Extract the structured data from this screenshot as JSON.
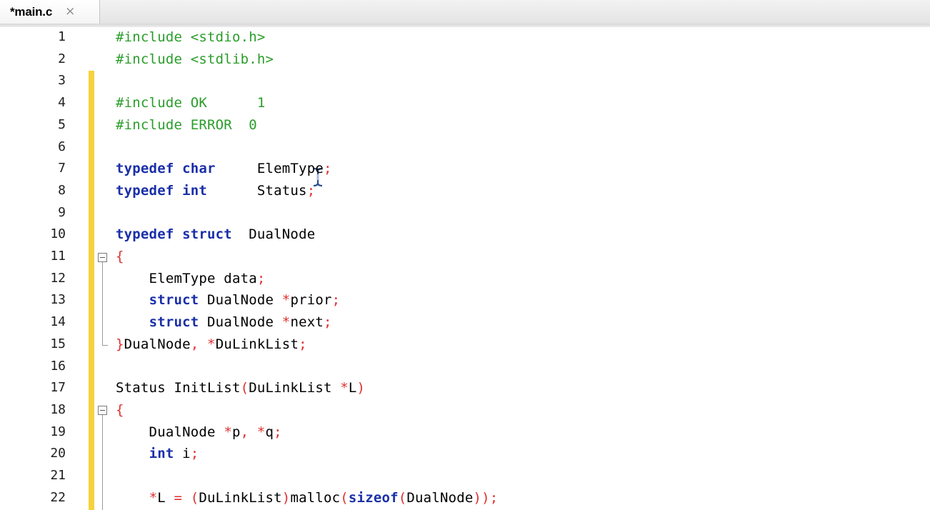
{
  "tab": {
    "title": "*main.c",
    "close_glyph": "×"
  },
  "lines": [
    {
      "n": "1",
      "tokens": [
        [
          "pp",
          "#include <stdio.h>"
        ]
      ]
    },
    {
      "n": "2",
      "tokens": [
        [
          "pp",
          "#include <stdlib.h>"
        ]
      ]
    },
    {
      "n": "3",
      "tokens": []
    },
    {
      "n": "4",
      "tokens": [
        [
          "pp",
          "#include OK      1"
        ]
      ]
    },
    {
      "n": "5",
      "tokens": [
        [
          "pp",
          "#include ERROR  0"
        ]
      ]
    },
    {
      "n": "6",
      "tokens": []
    },
    {
      "n": "7",
      "tokens": [
        [
          "kw",
          "typedef char"
        ],
        [
          "txt",
          "     ElemType"
        ],
        [
          "op",
          ";"
        ]
      ]
    },
    {
      "n": "8",
      "tokens": [
        [
          "kw",
          "typedef int"
        ],
        [
          "txt",
          "      Status"
        ],
        [
          "op",
          ";"
        ]
      ]
    },
    {
      "n": "9",
      "tokens": []
    },
    {
      "n": "10",
      "tokens": [
        [
          "kw",
          "typedef struct"
        ],
        [
          "txt",
          "  DualNode"
        ]
      ]
    },
    {
      "n": "11",
      "tokens": [
        [
          "op",
          "{"
        ]
      ]
    },
    {
      "n": "12",
      "tokens": [
        [
          "txt",
          "    ElemType data"
        ],
        [
          "op",
          ";"
        ]
      ]
    },
    {
      "n": "13",
      "tokens": [
        [
          "txt",
          "    "
        ],
        [
          "kw",
          "struct"
        ],
        [
          "txt",
          " DualNode "
        ],
        [
          "op",
          "*"
        ],
        [
          "txt",
          "prior"
        ],
        [
          "op",
          ";"
        ]
      ]
    },
    {
      "n": "14",
      "tokens": [
        [
          "txt",
          "    "
        ],
        [
          "kw",
          "struct"
        ],
        [
          "txt",
          " DualNode "
        ],
        [
          "op",
          "*"
        ],
        [
          "txt",
          "next"
        ],
        [
          "op",
          ";"
        ]
      ]
    },
    {
      "n": "15",
      "tokens": [
        [
          "op",
          "}"
        ],
        [
          "txt",
          "DualNode"
        ],
        [
          "op",
          ", *"
        ],
        [
          "txt",
          "DuLinkList"
        ],
        [
          "op",
          ";"
        ]
      ]
    },
    {
      "n": "16",
      "tokens": []
    },
    {
      "n": "17",
      "tokens": [
        [
          "txt",
          "Status InitList"
        ],
        [
          "op",
          "("
        ],
        [
          "txt",
          "DuLinkList "
        ],
        [
          "op",
          "*"
        ],
        [
          "txt",
          "L"
        ],
        [
          "op",
          ")"
        ]
      ]
    },
    {
      "n": "18",
      "tokens": [
        [
          "op",
          "{"
        ]
      ]
    },
    {
      "n": "19",
      "tokens": [
        [
          "txt",
          "    DualNode "
        ],
        [
          "op",
          "*"
        ],
        [
          "txt",
          "p"
        ],
        [
          "op",
          ", *"
        ],
        [
          "txt",
          "q"
        ],
        [
          "op",
          ";"
        ]
      ]
    },
    {
      "n": "20",
      "tokens": [
        [
          "txt",
          "    "
        ],
        [
          "kw",
          "int"
        ],
        [
          "txt",
          " i"
        ],
        [
          "op",
          ";"
        ]
      ]
    },
    {
      "n": "21",
      "tokens": []
    },
    {
      "n": "22",
      "tokens": [
        [
          "txt",
          "    "
        ],
        [
          "op",
          "*"
        ],
        [
          "txt",
          "L "
        ],
        [
          "op",
          "= ("
        ],
        [
          "txt",
          "DuLinkList"
        ],
        [
          "op",
          ")"
        ],
        [
          "txt",
          "malloc"
        ],
        [
          "op",
          "("
        ],
        [
          "kw",
          "sizeof"
        ],
        [
          "op",
          "("
        ],
        [
          "txt",
          "DualNode"
        ],
        [
          "op",
          "));"
        ]
      ]
    }
  ],
  "colors": {
    "preprocessor": "#2a9d2a",
    "keyword": "#1a2fa8",
    "operator": "#e03030",
    "text": "#000000",
    "change_bar": "#f6d23d"
  },
  "icons": {
    "fold": "fold-minus-icon",
    "cursor": "i-beam-cursor-icon"
  }
}
